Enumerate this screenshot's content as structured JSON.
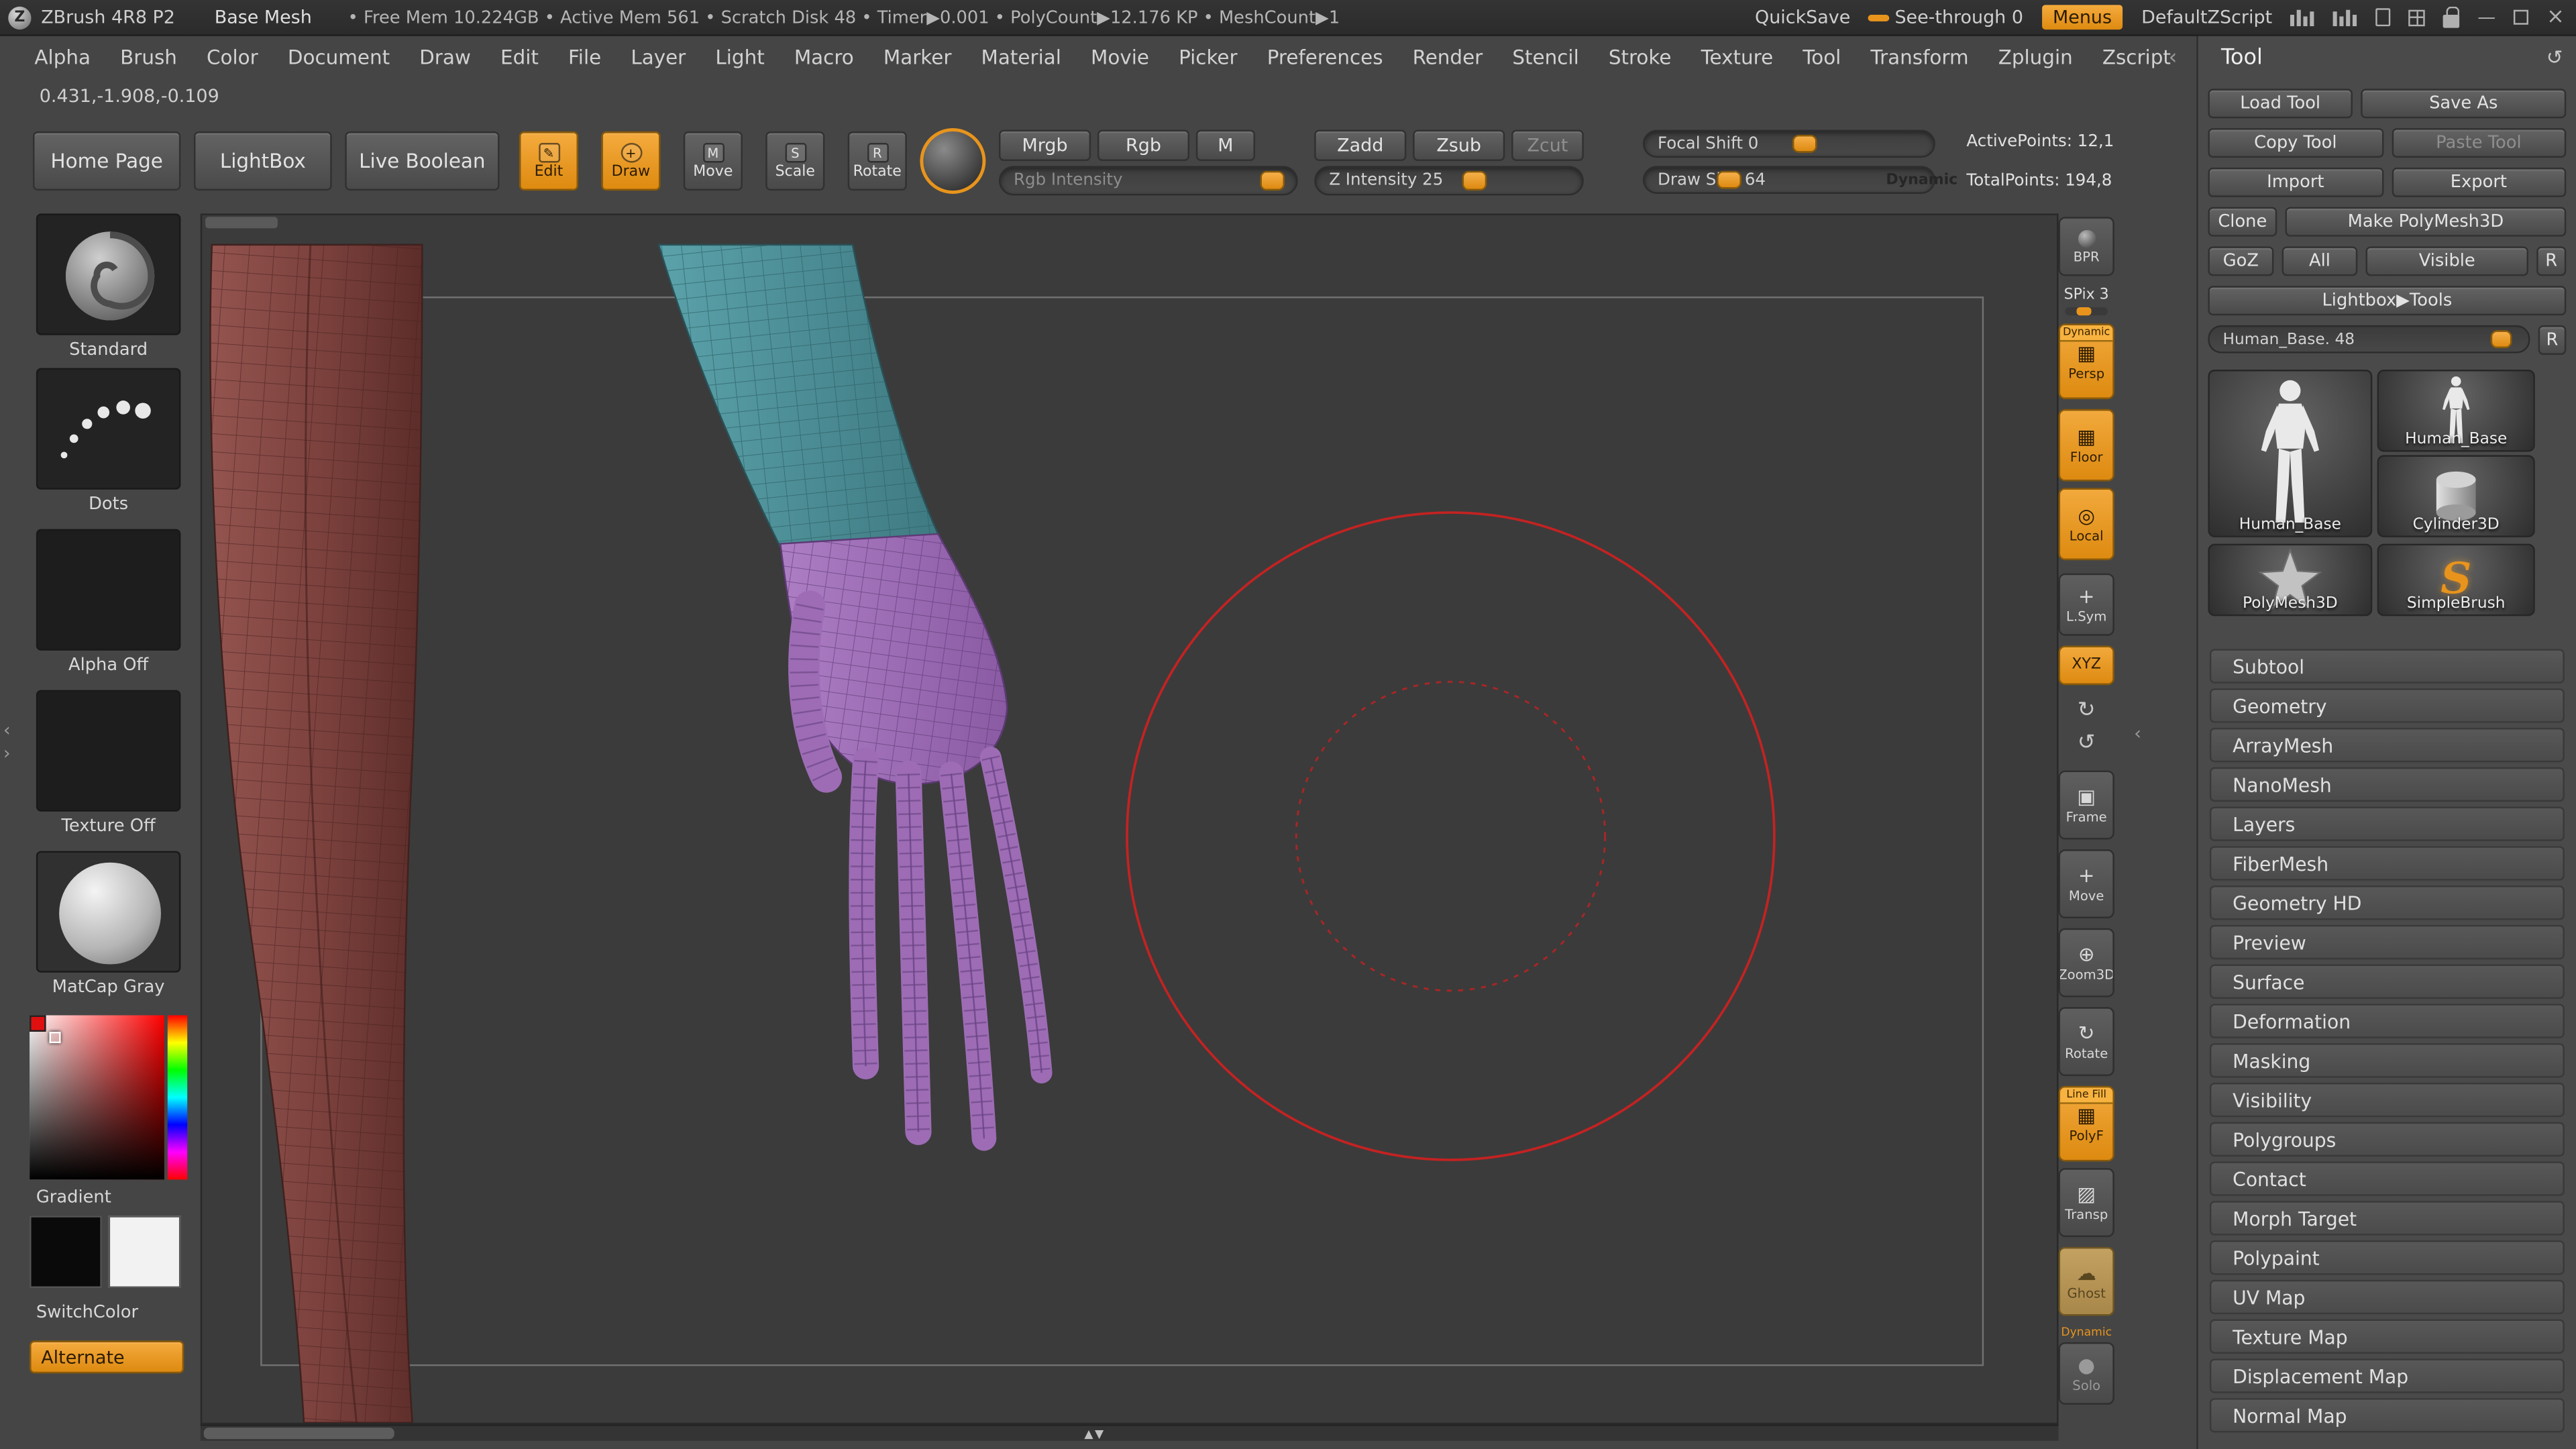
{
  "colors": {
    "accent": "#e8941c",
    "cursor_red": "#c42222"
  },
  "titlebar": {
    "app_title": "ZBrush 4R8 P2",
    "document_name": "Base Mesh",
    "stats": "• Free Mem 10.224GB • Active Mem 561 • Scratch Disk 48 • Timer▶0.001 • PolyCount▶12.176 KP • MeshCount▶1",
    "quicksave": "QuickSave",
    "see_through": "See-through 0",
    "menus": "Menus",
    "default_zscript": "DefaultZScript"
  },
  "menubar": {
    "items": [
      "Alpha",
      "Brush",
      "Color",
      "Document",
      "Draw",
      "Edit",
      "File",
      "Layer",
      "Light",
      "Macro",
      "Marker",
      "Material",
      "Movie",
      "Picker",
      "Preferences",
      "Render",
      "Stencil",
      "Stroke",
      "Texture",
      "Tool",
      "Transform",
      "Zplugin",
      "Zscript"
    ]
  },
  "coordinates": "0.431,-1.908,-0.109",
  "shelf": {
    "home_page": "Home Page",
    "lightbox": "LightBox",
    "live_boolean": "Live Boolean",
    "edit": "Edit",
    "draw": "Draw",
    "move": "Move",
    "scale": "Scale",
    "rotate": "Rotate",
    "mrgb": "Mrgb",
    "rgb": "Rgb",
    "m": "M",
    "rgb_intensity": "Rgb Intensity",
    "zadd": "Zadd",
    "zsub": "Zsub",
    "zcut": "Zcut",
    "z_intensity": "Z Intensity 25",
    "focal_shift": "Focal Shift 0",
    "draw_size": "Draw Size 64",
    "dynamic": "Dynamic",
    "active_points": "ActivePoints: 12,1",
    "total_points": "TotalPoints: 194,8"
  },
  "left_panel": {
    "brush_label": "Standard",
    "stroke_label": "Dots",
    "alpha_label": "Alpha Off",
    "texture_label": "Texture Off",
    "material_label": "MatCap Gray",
    "gradient_label": "Gradient",
    "switchcolor_label": "SwitchColor",
    "alternate_label": "Alternate"
  },
  "right_strip": {
    "bpr": "BPR",
    "spix": "SPix 3",
    "persp_header": "Dynamic",
    "persp": "Persp",
    "floor": "Floor",
    "local": "Local",
    "lsym": "L.Sym",
    "xyz": "XYZ",
    "frame": "Frame",
    "move": "Move",
    "zoom3d": "Zoom3D",
    "rotate": "Rotate",
    "polyf_header": "Line Fill",
    "polyf": "PolyF",
    "transp": "Transp",
    "ghost": "Ghost",
    "solo_header": "Dynamic",
    "solo": "Solo"
  },
  "tool_panel": {
    "title": "Tool",
    "load_tool": "Load Tool",
    "save_as": "Save As",
    "copy_tool": "Copy Tool",
    "paste_tool": "Paste Tool",
    "import": "Import",
    "export": "Export",
    "clone": "Clone",
    "make_polymesh3d": "Make PolyMesh3D",
    "goz": "GoZ",
    "all": "All",
    "visible": "Visible",
    "r_toggle": "R",
    "lightbox_tools": "Lightbox▶Tools",
    "tool_slider": "Human_Base. 48",
    "r_slider": "R",
    "thumbs": {
      "active": "Human_Base",
      "recent1": "Human_Base",
      "recent2": "Cylinder3D",
      "recent3": "PolyMesh3D",
      "recent4": "SimpleBrush"
    },
    "sections": [
      "Subtool",
      "Geometry",
      "ArrayMesh",
      "NanoMesh",
      "Layers",
      "FiberMesh",
      "Geometry HD",
      "Preview",
      "Surface",
      "Deformation",
      "Masking",
      "Visibility",
      "Polygroups",
      "Contact",
      "Morph Target",
      "Polypaint",
      "UV Map",
      "Texture Map",
      "Displacement Map",
      "Normal Map"
    ]
  },
  "icons": {
    "logo": "Z",
    "edit": "✎",
    "draw": "+",
    "move_letter": "M",
    "scale_letter": "S",
    "rotate_letter": "R",
    "persp": "▦",
    "floor": "▦",
    "local": "◎",
    "lsym": "+",
    "xyz_glyph": "✛",
    "frame": "▣",
    "move": "+",
    "zoom3d": "⊕",
    "rotate": "↻",
    "polyf": "▦",
    "transp": "▨",
    "ghost": "☁",
    "solo": "●",
    "spin_cw": "↻",
    "spin_ccw": "↺",
    "refresh": "↺",
    "chevron_left": "‹",
    "chevron_right": "›",
    "scroll_arrows": "▲▼",
    "minimize": "—",
    "close": "×",
    "simplebrush_glyph": "S"
  }
}
